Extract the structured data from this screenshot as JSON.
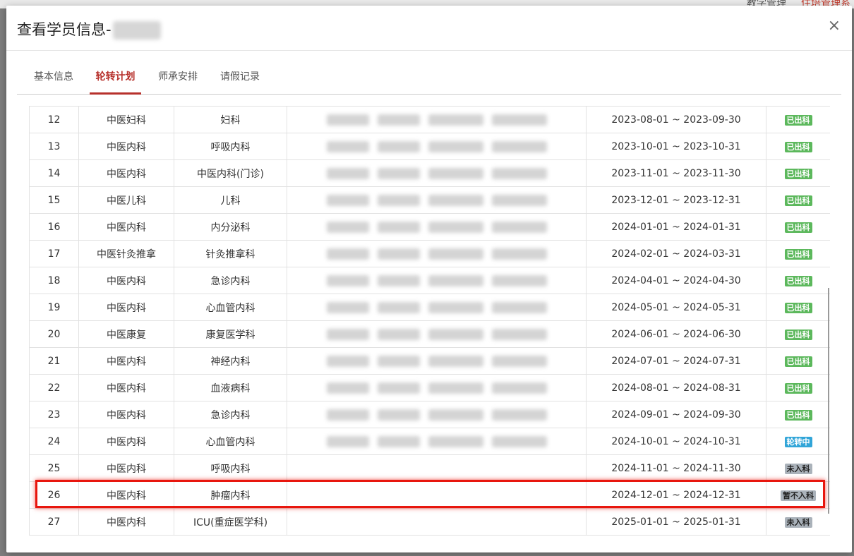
{
  "background": {
    "links": [
      "教学管理",
      "住培管理系统"
    ]
  },
  "modal": {
    "title": "查看学员信息-",
    "close": "×"
  },
  "tabs": [
    "基本信息",
    "轮转计划",
    "师承安排",
    "请假记录"
  ],
  "rows": [
    {
      "no": "12",
      "dept": "中医妇科",
      "sub": "妇科",
      "period": "2023-08-01 ~ 2023-09-30",
      "status": "已出科",
      "type": "done"
    },
    {
      "no": "13",
      "dept": "中医内科",
      "sub": "呼吸内科",
      "period": "2023-10-01 ~ 2023-10-31",
      "status": "已出科",
      "type": "done"
    },
    {
      "no": "14",
      "dept": "中医内科",
      "sub": "中医内科(门诊)",
      "period": "2023-11-01 ~ 2023-11-30",
      "status": "已出科",
      "type": "done"
    },
    {
      "no": "15",
      "dept": "中医儿科",
      "sub": "儿科",
      "period": "2023-12-01 ~ 2023-12-31",
      "status": "已出科",
      "type": "done"
    },
    {
      "no": "16",
      "dept": "中医内科",
      "sub": "内分泌科",
      "period": "2024-01-01 ~ 2024-01-31",
      "status": "已出科",
      "type": "done"
    },
    {
      "no": "17",
      "dept": "中医针灸推拿",
      "sub": "针灸推拿科",
      "period": "2024-02-01 ~ 2024-03-31",
      "status": "已出科",
      "type": "done"
    },
    {
      "no": "18",
      "dept": "中医内科",
      "sub": "急诊内科",
      "period": "2024-04-01 ~ 2024-04-30",
      "status": "已出科",
      "type": "done"
    },
    {
      "no": "19",
      "dept": "中医内科",
      "sub": "心血管内科",
      "period": "2024-05-01 ~ 2024-05-31",
      "status": "已出科",
      "type": "done"
    },
    {
      "no": "20",
      "dept": "中医康复",
      "sub": "康复医学科",
      "period": "2024-06-01 ~ 2024-06-30",
      "status": "已出科",
      "type": "done"
    },
    {
      "no": "21",
      "dept": "中医内科",
      "sub": "神经内科",
      "period": "2024-07-01 ~ 2024-07-31",
      "status": "已出科",
      "type": "done"
    },
    {
      "no": "22",
      "dept": "中医内科",
      "sub": "血液病科",
      "period": "2024-08-01 ~ 2024-08-31",
      "status": "已出科",
      "type": "done"
    },
    {
      "no": "23",
      "dept": "中医内科",
      "sub": "急诊内科",
      "period": "2024-09-01 ~ 2024-09-30",
      "status": "已出科",
      "type": "done"
    },
    {
      "no": "24",
      "dept": "中医内科",
      "sub": "心血管内科",
      "period": "2024-10-01 ~ 2024-10-31",
      "status": "轮转中",
      "type": "active"
    },
    {
      "no": "25",
      "dept": "中医内科",
      "sub": "呼吸内科",
      "period": "2024-11-01 ~ 2024-11-30",
      "status": "未入科",
      "type": "pending"
    },
    {
      "no": "26",
      "dept": "中医内科",
      "sub": "肿瘤内科",
      "period": "2024-12-01 ~ 2024-12-31",
      "status": "暂不入科",
      "type": "pending"
    },
    {
      "no": "27",
      "dept": "中医内科",
      "sub": "ICU(重症医学科)",
      "period": "2025-01-01 ~ 2025-01-31",
      "status": "未入科",
      "type": "pending"
    }
  ]
}
